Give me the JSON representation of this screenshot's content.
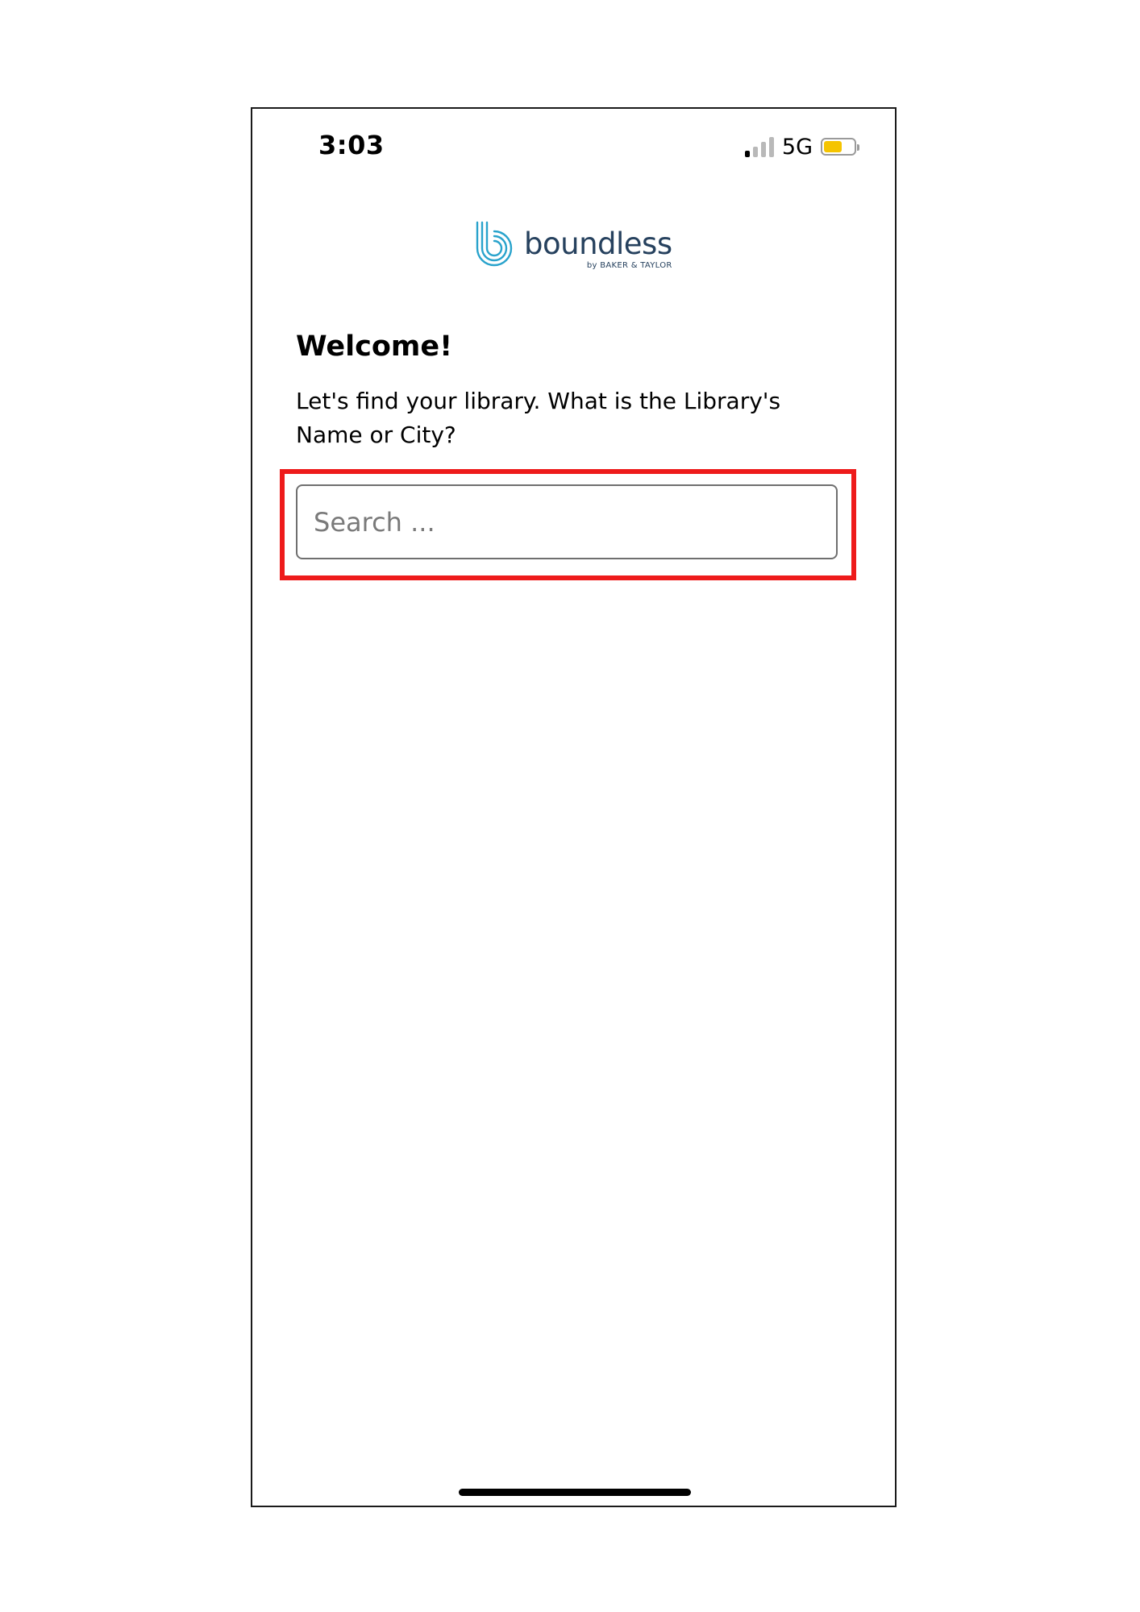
{
  "status_bar": {
    "time": "3:03",
    "network": "5G",
    "signal_bars_active": 1,
    "signal_bars_total": 4,
    "battery_level": 0.6,
    "battery_color": "#f5c400"
  },
  "logo": {
    "name": "boundless",
    "tagline": "by BAKER & TAYLOR",
    "mark_color": "#29a3cc",
    "text_color": "#26415e"
  },
  "welcome": {
    "heading": "Welcome!",
    "prompt": "Let's find your library. What is the Library's Name or City?"
  },
  "search": {
    "placeholder": "Search ...",
    "value": ""
  },
  "highlight": {
    "color": "#ee1b1b"
  }
}
